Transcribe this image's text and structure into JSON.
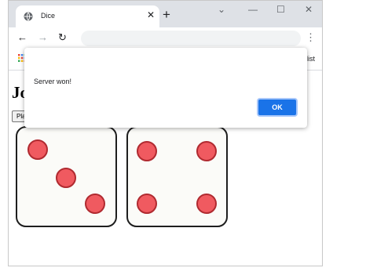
{
  "browser": {
    "tab_title": "Dice",
    "tab_close": "✕",
    "new_tab": "+",
    "window_controls": {
      "minimize": "—",
      "maximize": "☐",
      "close": "✕",
      "dropdown": "⌄"
    },
    "nav": {
      "back": "←",
      "forward": "→",
      "reload": "↻"
    },
    "menu": "⋮",
    "bookmarks_right_text": "list"
  },
  "page": {
    "heading": "Jo",
    "play_button_label": "Pla",
    "dice": [
      {
        "face_value": 3
      },
      {
        "face_value": 4
      }
    ]
  },
  "dialog": {
    "message": "Server won!",
    "ok_label": "OK"
  },
  "colors": {
    "accent_blue": "#1a73e8",
    "pip_fill": "#f05a60",
    "pip_stroke": "#b02a30"
  },
  "icons": [
    "globe-icon",
    "close-icon",
    "plus-icon",
    "back-icon",
    "forward-icon",
    "reload-icon",
    "kebab-menu-icon",
    "apps-grid-icon"
  ]
}
